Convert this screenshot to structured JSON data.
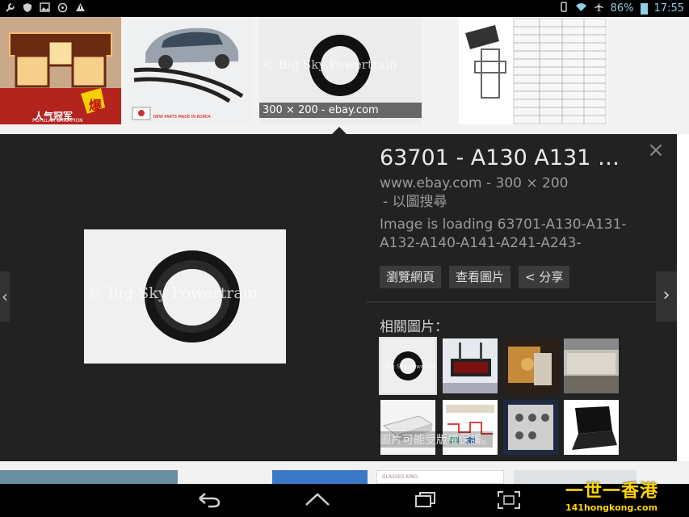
{
  "status_bar": {
    "left_icons": [
      "wrench-icon",
      "shield-icon",
      "image-icon",
      "sync-icon",
      "warning-icon"
    ],
    "battery": "86%",
    "time": "17:55"
  },
  "thumb_strip": {
    "selected_caption": "300 × 200 - ebay.com",
    "lamp_text": "人气冠军",
    "lamp_badge": "爆",
    "lamp_sub": "POPULAR CHAMPION",
    "car_text": "NEW PARTS MADE IN KOREA"
  },
  "preview": {
    "watermark": "© Big Sky Powertrain",
    "title": "63701 - A130 A131 …",
    "source": "www.ebay.com - 300 × 200",
    "search_by_image": "- 以圖搜尋",
    "description": "Image is loading 63701-A130-A131-A132-A140-A141-A241-A243-",
    "buttons": {
      "visit": "瀏覽網頁",
      "view": "查看圖片",
      "share": "< 分享"
    },
    "related_heading": "相關圖片：",
    "related_notice": "圖片可能受版權保護。",
    "related_watermark": "Big Sky Powertrain"
  },
  "bottom_strip": {
    "glasses_label": "GLASSES KING"
  },
  "nav_bar": {
    "icons": [
      "back-icon",
      "home-icon",
      "recents-icon",
      "screenshot-icon"
    ]
  },
  "watermark_logo": {
    "main": "一世一香港",
    "url": "141hongkong.com"
  }
}
